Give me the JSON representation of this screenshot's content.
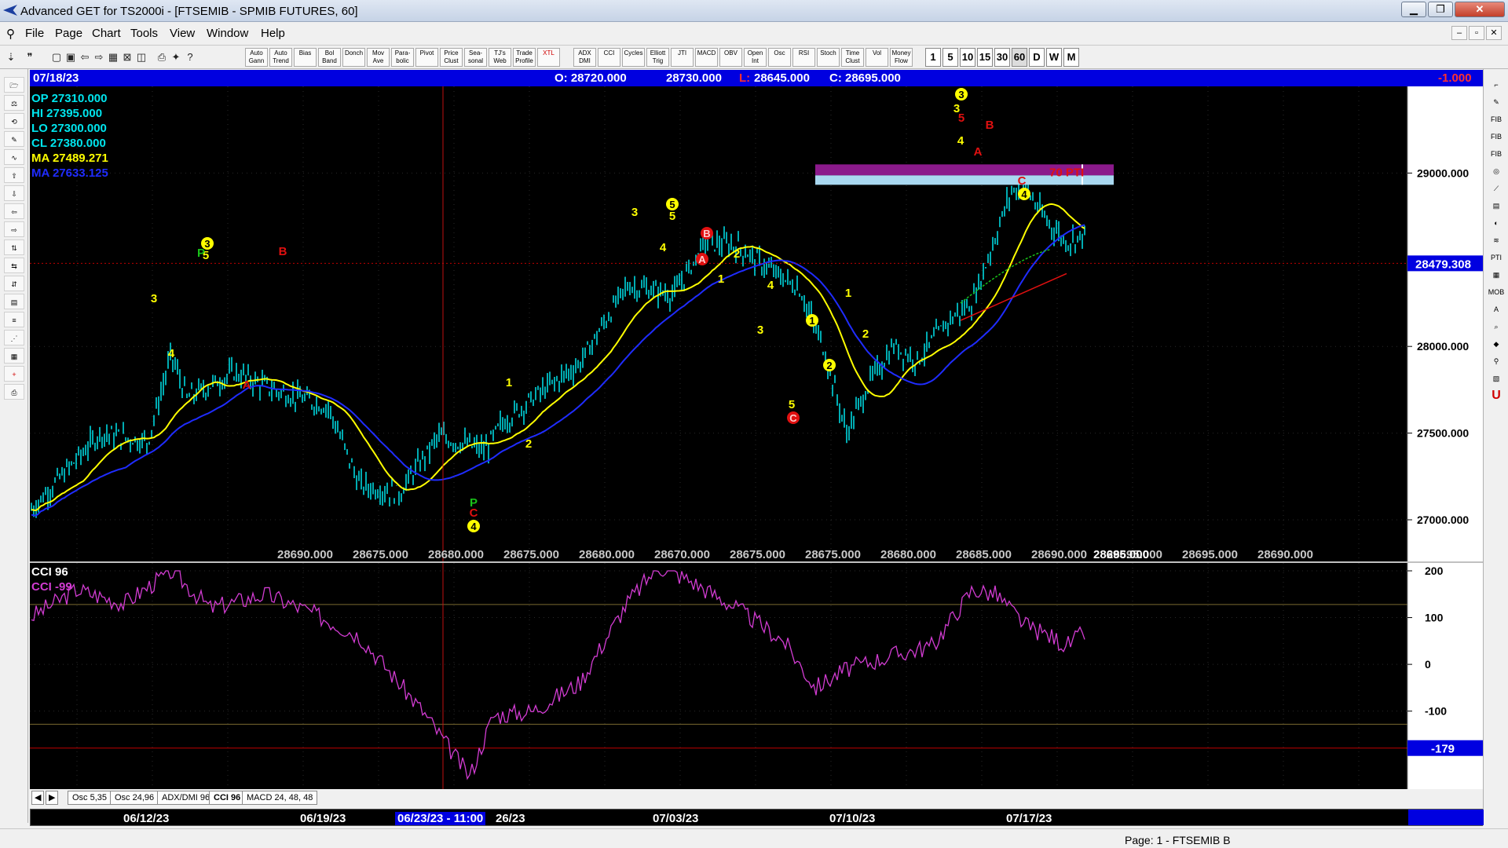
{
  "window": {
    "title": "Advanced GET for TS2000i - [FTSEMIB - SPMIB FUTURES, 60]",
    "controls": {
      "minimize": "▁",
      "restore": "❐",
      "close": "✕"
    }
  },
  "menu": {
    "items": [
      "File",
      "Page",
      "Chart",
      "Tools",
      "View",
      "Window",
      "Help"
    ],
    "mdi": {
      "minimize": "–",
      "restore": "▫",
      "close": "✕"
    }
  },
  "toolbar": {
    "studies": [
      "Auto Gann",
      "Auto Trend",
      "Bias",
      "Bol Band",
      "Donch",
      "Mov Ave",
      "Para-bolic",
      "Pivot",
      "Price Clust",
      "Sea-sonal",
      "TJ's Web",
      "Trade Profile",
      "XTL",
      "ADX DMI",
      "CCI",
      "Cycles",
      "Elliott Trig",
      "JTI",
      "MACD",
      "OBV",
      "Open Int",
      "Osc",
      "RSI",
      "Stoch",
      "Time Clust",
      "Vol",
      "Money Flow"
    ],
    "timeframes": [
      "1",
      "5",
      "10",
      "15",
      "30",
      "60",
      "D",
      "W",
      "M"
    ],
    "selected_timeframe": "60"
  },
  "left_tools": [
    "Elliott",
    "RESET",
    "STUDY",
    "LINES",
    "GANN",
    "FIB"
  ],
  "right_tools": [
    "FIB RET",
    "FIB EXT",
    "FIB TIME",
    "PTI",
    "ELPS",
    "MOB",
    "U"
  ],
  "info_bar": {
    "date": "07/18/23",
    "open": "O: 28720.000",
    "high": "28730.000",
    "low_label": "L:",
    "low": "28645.000",
    "close": "C: 28695.000",
    "change": "-1.000"
  },
  "legend": {
    "op": "OP  27310.000",
    "hi": "HI   27395.000",
    "lo": "LO  27300.000",
    "cl": "CL  27380.000",
    "ma1": "MA  27489.271",
    "ma2": "MA  27633.125",
    "colors": {
      "text": "#00e5ee",
      "ma1": "#ffff00",
      "ma2": "#1f2cff"
    }
  },
  "price_scale": {
    "ticks": [
      "29000.000",
      "28000.000",
      "27500.000",
      "27000.000"
    ],
    "tick_values": [
      29000,
      28000,
      27500,
      27000
    ],
    "current_label": "28479.308",
    "current_value": 28479.308,
    "range": [
      26760,
      29500
    ]
  },
  "bottom_values": [
    "28690.000",
    "28675.000",
    "28680.000",
    "28675.000",
    "28680.000",
    "28670.000",
    "28675.000",
    "28675.000",
    "28680.000",
    "28685.000",
    "28690.000",
    "28695.000",
    "28695.000",
    "28690.000",
    "28695.000"
  ],
  "pti": {
    "label": "70 PTI"
  },
  "cci": {
    "title": "CCI 96",
    "value_label": "CCI  -99",
    "ticks": [
      "200",
      "100",
      "0",
      "-100"
    ],
    "current_label": "-179",
    "color": "#d23cd2"
  },
  "tabs": [
    "Osc 5,35",
    "Osc 24,96",
    "ADX/DMI 96",
    "CCI 96",
    "MACD 24, 48, 48"
  ],
  "dates": {
    "d1": "06/12/23",
    "d2": "06/19/23",
    "cursor": "06/23/23 - 11:00",
    "d3": "26/23",
    "d4": "07/03/23",
    "d5": "07/10/23",
    "d6": "07/17/23"
  },
  "status": {
    "page": "Page: 1 - FTSEMIB B"
  },
  "elliott_labels": [
    {
      "t": "3",
      "c": "yellow"
    },
    {
      "t": "4",
      "c": "yellow"
    },
    {
      "t": "3",
      "c": "circle"
    },
    {
      "t": "5",
      "c": "yellow"
    },
    {
      "t": "P",
      "c": "green"
    },
    {
      "t": "A",
      "c": "red"
    },
    {
      "t": "B",
      "c": "red"
    },
    {
      "t": "P",
      "c": "green"
    },
    {
      "t": "C",
      "c": "red"
    },
    {
      "t": "4",
      "c": "circle"
    },
    {
      "t": "1",
      "c": "yellow"
    },
    {
      "t": "2",
      "c": "yellow"
    },
    {
      "t": "3",
      "c": "yellow"
    },
    {
      "t": "5",
      "c": "circle"
    },
    {
      "t": "5",
      "c": "yellow"
    },
    {
      "t": "4",
      "c": "yellow"
    },
    {
      "t": "B",
      "c": "redcircle"
    },
    {
      "t": "A",
      "c": "redcircle"
    },
    {
      "t": "2",
      "c": "yellow"
    },
    {
      "t": "1",
      "c": "yellow"
    },
    {
      "t": "4",
      "c": "yellow"
    },
    {
      "t": "3",
      "c": "yellow"
    },
    {
      "t": "5",
      "c": "yellow"
    },
    {
      "t": "C",
      "c": "redcircle"
    },
    {
      "t": "1",
      "c": "circle"
    },
    {
      "t": "2",
      "c": "circle"
    },
    {
      "t": "1",
      "c": "yellow"
    },
    {
      "t": "2",
      "c": "yellow"
    },
    {
      "t": "3",
      "c": "circle"
    },
    {
      "t": "3",
      "c": "yellow"
    },
    {
      "t": "5",
      "c": "red"
    },
    {
      "t": "4",
      "c": "yellow"
    },
    {
      "t": "B",
      "c": "red"
    },
    {
      "t": "A",
      "c": "red"
    },
    {
      "t": "C",
      "c": "red"
    },
    {
      "t": "4",
      "c": "circle"
    }
  ]
}
